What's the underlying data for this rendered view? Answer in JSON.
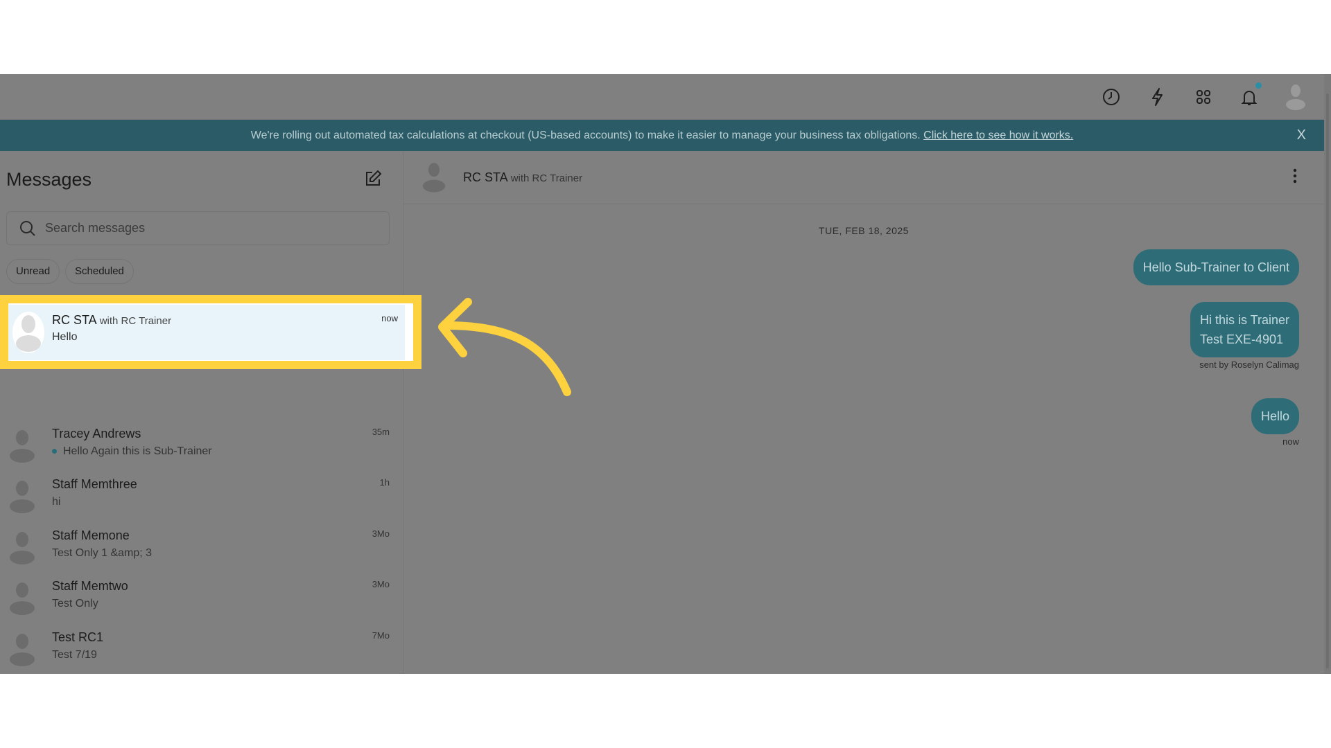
{
  "topbar": {
    "icons": [
      "clock-icon",
      "lightning-icon",
      "apps-grid-icon",
      "bell-icon",
      "user-avatar-icon"
    ],
    "notification_dot_color": "#2a8fa5"
  },
  "banner": {
    "text": "We're rolling out automated tax calculations at checkout (US-based accounts) to make it easier to manage your business tax obligations.",
    "link": "Click here to see how it works.",
    "close": "X"
  },
  "sidebar": {
    "title": "Messages",
    "search_placeholder": "Search messages",
    "filters": [
      "Unread",
      "Scheduled"
    ],
    "conversations": [
      {
        "name": "RC STA",
        "with": "with RC Trainer",
        "preview": "Hello",
        "time": "now",
        "selected": true
      },
      {
        "name": "Tracey Andrews",
        "preview": "Hello Again this is Sub-Trainer",
        "time": "35m",
        "unread": true
      },
      {
        "name": "Staff Memthree",
        "preview": "hi",
        "time": "1h"
      },
      {
        "name": "Staff Memone",
        "preview": "Test Only 1 &amp; 3",
        "time": "3Mo"
      },
      {
        "name": "Staff Memtwo",
        "preview": "Test Only",
        "time": "3Mo"
      },
      {
        "name": "Test RC1",
        "preview": "Test 7/19",
        "time": "7Mo"
      }
    ]
  },
  "chat": {
    "name": "RC STA",
    "with": "with RC Trainer",
    "date": "TUE, FEB 18, 2025",
    "messages": [
      {
        "text": "Hello Sub-Trainer to Client"
      },
      {
        "line1": "Hi this is Trainer",
        "line2": "Test EXE-4901",
        "meta": "sent by Roselyn Calimag"
      },
      {
        "text": "Hello",
        "meta": "now"
      }
    ]
  },
  "annotation": {
    "highlight_color": "#fdd23e"
  }
}
